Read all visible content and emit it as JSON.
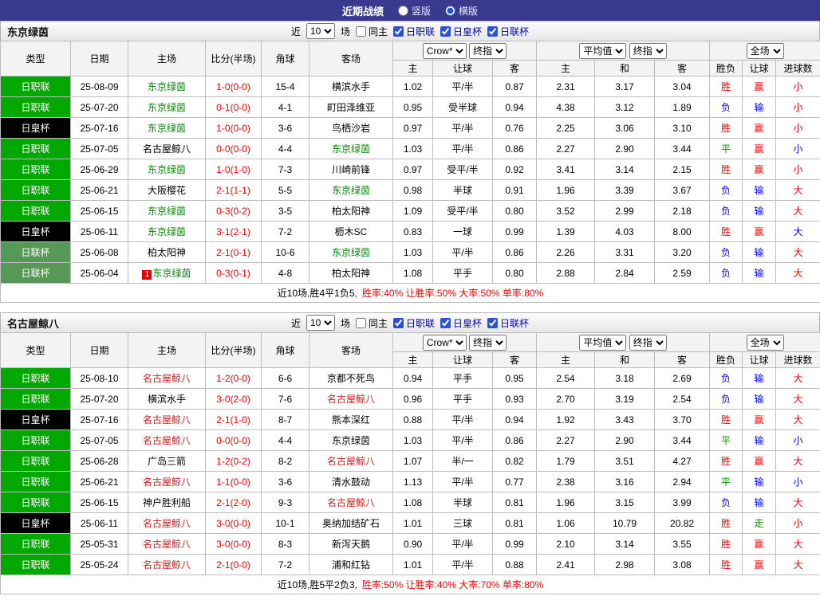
{
  "topbar": {
    "title": "近期战绩",
    "radios": [
      {
        "label": "竖版",
        "checked": false
      },
      {
        "label": "横版",
        "checked": true
      }
    ]
  },
  "controls": {
    "near": "近",
    "rounds": "10",
    "games": "场",
    "same_home": "同主",
    "same_home_checked": false,
    "league_filters": [
      {
        "label": "日职联",
        "checked": true
      },
      {
        "label": "日皇杯",
        "checked": true
      },
      {
        "label": "日联杯",
        "checked": true
      }
    ]
  },
  "table_header": {
    "type": "类型",
    "date": "日期",
    "home": "主场",
    "score": "比分(半场)",
    "corner": "角球",
    "away": "客场",
    "odds_source": "Crow*",
    "final_index": "终指",
    "average": "平均值",
    "final_index2": "终指",
    "full_match": "全场",
    "home_odds": "主",
    "handicap": "让球",
    "away_odds": "客",
    "home_avg": "主",
    "draw_avg": "和",
    "away_avg": "客",
    "wdl": "胜负",
    "handicap_result": "让球",
    "goals": "进球数"
  },
  "palette": {
    "topbar_bg": "#39398f",
    "score": "#ff0000",
    "leagues": {
      "日职联": "#00a800",
      "日皇杯": "#000000",
      "日联杯": "#569956"
    },
    "results": {
      "red": "#ff0000",
      "blue": "#0000ff",
      "green": "#009900"
    },
    "team_highlights": {
      "东京绿茵": "#008800",
      "名古屋鲸八": "#cc2222"
    }
  },
  "sections": [
    {
      "team": "东京绿茵",
      "rows": [
        {
          "league": "日职联",
          "date": "25-08-09",
          "home": "东京绿茵",
          "home_color": "#008800",
          "score": "1-0(0-0)",
          "corner": "15-4",
          "away": "横滨水手",
          "odds": [
            "1.02",
            "平/半",
            "0.87",
            "2.31",
            "3.17",
            "3.04"
          ],
          "results": [
            [
              "胜",
              "red"
            ],
            [
              "赢",
              "red"
            ],
            [
              "小",
              "red"
            ]
          ]
        },
        {
          "league": "日职联",
          "date": "25-07-20",
          "home": "东京绿茵",
          "home_color": "#008800",
          "score": "0-1(0-0)",
          "corner": "4-1",
          "away": "町田泽维亚",
          "odds": [
            "0.95",
            "受半球",
            "0.94",
            "4.38",
            "3.12",
            "1.89"
          ],
          "results": [
            [
              "负",
              "blue"
            ],
            [
              "输",
              "blue"
            ],
            [
              "小",
              "red"
            ]
          ]
        },
        {
          "league": "日皇杯",
          "date": "25-07-16",
          "home": "东京绿茵",
          "home_color": "#008800",
          "score": "1-0(0-0)",
          "corner": "3-6",
          "away": "鸟栖沙岩",
          "odds": [
            "0.97",
            "平/半",
            "0.76",
            "2.25",
            "3.06",
            "3.10"
          ],
          "results": [
            [
              "胜",
              "red"
            ],
            [
              "赢",
              "red"
            ],
            [
              "小",
              "red"
            ]
          ]
        },
        {
          "league": "日职联",
          "date": "25-07-05",
          "home": "名古屋鲸八",
          "score": "0-0(0-0)",
          "corner": "4-4",
          "away": "东京绿茵",
          "away_color": "#008800",
          "odds": [
            "1.03",
            "平/半",
            "0.86",
            "2.27",
            "2.90",
            "3.44"
          ],
          "results": [
            [
              "平",
              "green"
            ],
            [
              "赢",
              "red"
            ],
            [
              "小",
              "blue"
            ]
          ]
        },
        {
          "league": "日职联",
          "date": "25-06-29",
          "home": "东京绿茵",
          "home_color": "#008800",
          "score": "1-0(1-0)",
          "corner": "7-3",
          "away": "川崎前锋",
          "odds": [
            "0.97",
            "受平/半",
            "0.92",
            "3.41",
            "3.14",
            "2.15"
          ],
          "results": [
            [
              "胜",
              "red"
            ],
            [
              "赢",
              "red"
            ],
            [
              "小",
              "red"
            ]
          ]
        },
        {
          "league": "日职联",
          "date": "25-06-21",
          "home": "大阪樱花",
          "score": "2-1(1-1)",
          "corner": "5-5",
          "away": "东京绿茵",
          "away_color": "#008800",
          "odds": [
            "0.98",
            "半球",
            "0.91",
            "1.96",
            "3.39",
            "3.67"
          ],
          "results": [
            [
              "负",
              "blue"
            ],
            [
              "输",
              "blue"
            ],
            [
              "大",
              "red"
            ]
          ]
        },
        {
          "league": "日职联",
          "date": "25-06-15",
          "home": "东京绿茵",
          "home_color": "#008800",
          "score": "0-3(0-2)",
          "corner": "3-5",
          "away": "柏太阳神",
          "odds": [
            "1.09",
            "受平/半",
            "0.80",
            "3.52",
            "2.99",
            "2.18"
          ],
          "results": [
            [
              "负",
              "blue"
            ],
            [
              "输",
              "blue"
            ],
            [
              "大",
              "red"
            ]
          ]
        },
        {
          "league": "日皇杯",
          "date": "25-06-11",
          "home": "东京绿茵",
          "home_color": "#008800",
          "score": "3-1(2-1)",
          "corner": "7-2",
          "away": "枥木SC",
          "odds": [
            "0.83",
            "一球",
            "0.99",
            "1.39",
            "4.03",
            "8.00"
          ],
          "results": [
            [
              "胜",
              "red"
            ],
            [
              "赢",
              "red"
            ],
            [
              "大",
              "blue"
            ]
          ]
        },
        {
          "league": "日联杯",
          "date": "25-06-08",
          "home": "柏太阳神",
          "score": "2-1(0-1)",
          "corner": "10-6",
          "away": "东京绿茵",
          "away_color": "#008800",
          "odds": [
            "1.03",
            "平/半",
            "0.86",
            "2.26",
            "3.31",
            "3.20"
          ],
          "results": [
            [
              "负",
              "blue"
            ],
            [
              "输",
              "blue"
            ],
            [
              "大",
              "red"
            ]
          ]
        },
        {
          "league": "日联杯",
          "date": "25-06-04",
          "home": "东京绿茵",
          "home_color": "#008800",
          "badge": "1",
          "score": "0-3(0-1)",
          "corner": "4-8",
          "away": "柏太阳神",
          "odds": [
            "1.08",
            "平手",
            "0.80",
            "2.88",
            "2.84",
            "2.59"
          ],
          "results": [
            [
              "负",
              "blue"
            ],
            [
              "输",
              "blue"
            ],
            [
              "大",
              "red"
            ]
          ]
        }
      ],
      "summary": {
        "prefix": "近10场,胜4平1负5,",
        "stats": [
          "胜率:40%",
          "让胜率:50%",
          "大率:50%",
          "单率:80%"
        ]
      }
    },
    {
      "team": "名古屋鲸八",
      "rows": [
        {
          "league": "日职联",
          "date": "25-08-10",
          "home": "名古屋鲸八",
          "home_color": "#cc2222",
          "score": "1-2(0-0)",
          "corner": "6-6",
          "away": "京都不死鸟",
          "odds": [
            "0.94",
            "平手",
            "0.95",
            "2.54",
            "3.18",
            "2.69"
          ],
          "results": [
            [
              "负",
              "blue"
            ],
            [
              "输",
              "blue"
            ],
            [
              "大",
              "red"
            ]
          ]
        },
        {
          "league": "日职联",
          "date": "25-07-20",
          "home": "横滨水手",
          "score": "3-0(2-0)",
          "corner": "7-6",
          "away": "名古屋鲸八",
          "away_color": "#cc2222",
          "odds": [
            "0.96",
            "平手",
            "0.93",
            "2.70",
            "3.19",
            "2.54"
          ],
          "results": [
            [
              "负",
              "blue"
            ],
            [
              "输",
              "blue"
            ],
            [
              "大",
              "red"
            ]
          ]
        },
        {
          "league": "日皇杯",
          "date": "25-07-16",
          "home": "名古屋鲸八",
          "home_color": "#cc2222",
          "score": "2-1(1-0)",
          "corner": "8-7",
          "away": "熊本深红",
          "odds": [
            "0.88",
            "平/半",
            "0.94",
            "1.92",
            "3.43",
            "3.70"
          ],
          "results": [
            [
              "胜",
              "red"
            ],
            [
              "赢",
              "red"
            ],
            [
              "大",
              "red"
            ]
          ]
        },
        {
          "league": "日职联",
          "date": "25-07-05",
          "home": "名古屋鲸八",
          "home_color": "#cc2222",
          "score": "0-0(0-0)",
          "corner": "4-4",
          "away": "东京绿茵",
          "odds": [
            "1.03",
            "平/半",
            "0.86",
            "2.27",
            "2.90",
            "3.44"
          ],
          "results": [
            [
              "平",
              "green"
            ],
            [
              "输",
              "blue"
            ],
            [
              "小",
              "blue"
            ]
          ]
        },
        {
          "league": "日职联",
          "date": "25-06-28",
          "home": "广岛三箭",
          "score": "1-2(0-2)",
          "corner": "8-2",
          "away": "名古屋鲸八",
          "away_color": "#cc2222",
          "odds": [
            "1.07",
            "半/一",
            "0.82",
            "1.79",
            "3.51",
            "4.27"
          ],
          "results": [
            [
              "胜",
              "red"
            ],
            [
              "赢",
              "red"
            ],
            [
              "大",
              "red"
            ]
          ]
        },
        {
          "league": "日职联",
          "date": "25-06-21",
          "home": "名古屋鲸八",
          "home_color": "#cc2222",
          "score": "1-1(0-0)",
          "corner": "3-6",
          "away": "清水鼓动",
          "odds": [
            "1.13",
            "平/半",
            "0.77",
            "2.38",
            "3.16",
            "2.94"
          ],
          "results": [
            [
              "平",
              "green"
            ],
            [
              "输",
              "blue"
            ],
            [
              "小",
              "blue"
            ]
          ]
        },
        {
          "league": "日职联",
          "date": "25-06-15",
          "home": "神户胜利船",
          "score": "2-1(2-0)",
          "corner": "9-3",
          "away": "名古屋鲸八",
          "away_color": "#cc2222",
          "odds": [
            "1.08",
            "半球",
            "0.81",
            "1.96",
            "3.15",
            "3.99"
          ],
          "results": [
            [
              "负",
              "blue"
            ],
            [
              "输",
              "blue"
            ],
            [
              "大",
              "red"
            ]
          ]
        },
        {
          "league": "日皇杯",
          "date": "25-06-11",
          "home": "名古屋鲸八",
          "home_color": "#cc2222",
          "score": "3-0(0-0)",
          "corner": "10-1",
          "away": "奥纳加结矿石",
          "odds": [
            "1.01",
            "三球",
            "0.81",
            "1.06",
            "10.79",
            "20.82"
          ],
          "results": [
            [
              "胜",
              "red"
            ],
            [
              "走",
              "green"
            ],
            [
              "小",
              "red"
            ]
          ]
        },
        {
          "league": "日职联",
          "date": "25-05-31",
          "home": "名古屋鲸八",
          "home_color": "#cc2222",
          "score": "3-0(0-0)",
          "corner": "8-3",
          "away": "新泻天鹅",
          "odds": [
            "0.90",
            "平/半",
            "0.99",
            "2.10",
            "3.14",
            "3.55"
          ],
          "results": [
            [
              "胜",
              "red"
            ],
            [
              "赢",
              "red"
            ],
            [
              "大",
              "red"
            ]
          ]
        },
        {
          "league": "日职联",
          "date": "25-05-24",
          "home": "名古屋鲸八",
          "home_color": "#cc2222",
          "score": "2-1(0-0)",
          "corner": "7-2",
          "away": "浦和红钻",
          "odds": [
            "1.01",
            "平/半",
            "0.88",
            "2.41",
            "2.98",
            "3.08"
          ],
          "results": [
            [
              "胜",
              "red"
            ],
            [
              "赢",
              "red"
            ],
            [
              "大",
              "red"
            ]
          ]
        }
      ],
      "summary": {
        "prefix": "近10场,胜5平2负3,",
        "stats": [
          "胜率:50%",
          "让胜率:40%",
          "大率:70%",
          "单率:80%"
        ]
      }
    }
  ]
}
